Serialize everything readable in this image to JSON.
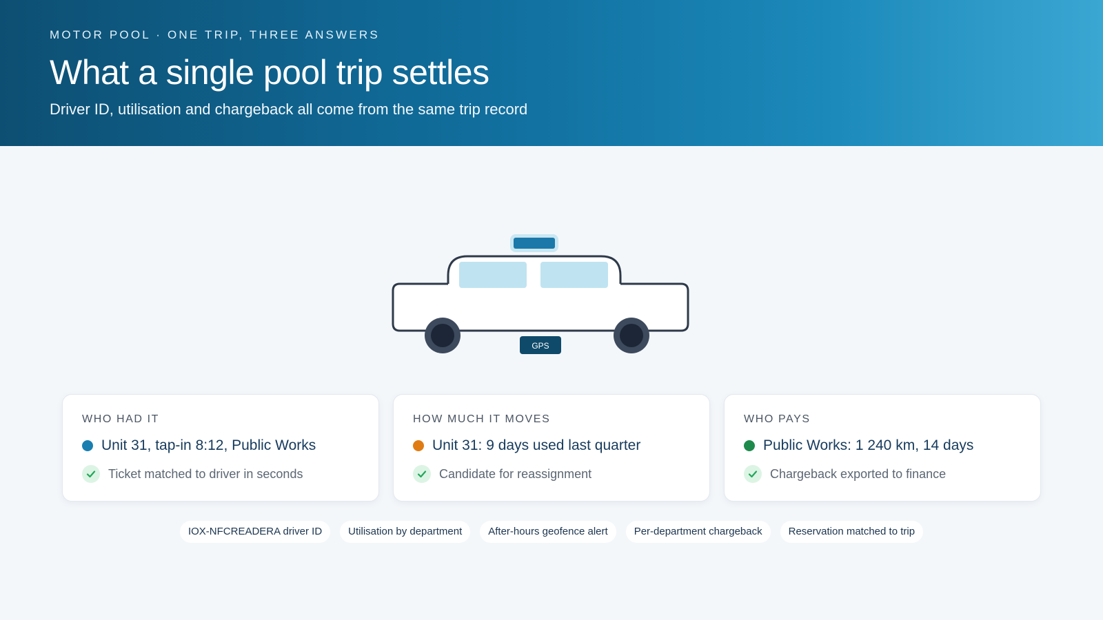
{
  "header": {
    "eyebrow": "MOTOR POOL · ONE TRIP, THREE ANSWERS",
    "title": "What a single pool trip settles",
    "subtitle": "Driver ID, utilisation and chargeback all come from the same trip record"
  },
  "vehicle": {
    "badge_label": "GPS",
    "icon": "pool-car-illustration"
  },
  "cards": [
    {
      "label": "WHO HAD IT",
      "value": "Unit 31, tap-in 8:12, Public Works",
      "note": "Ticket matched to driver in seconds",
      "dot_color": "#1a7fb0"
    },
    {
      "label": "HOW MUCH IT MOVES",
      "value": "Unit 31: 9 days used last quarter",
      "note": "Candidate for reassignment",
      "dot_color": "#e07b14"
    },
    {
      "label": "WHO PAYS",
      "value": "Public Works: 1 240 km, 14 days",
      "note": "Chargeback exported to finance",
      "dot_color": "#1e8a4c"
    }
  ],
  "chips": [
    "IOX-NFCREADERA driver ID",
    "Utilisation by department",
    "After-hours geofence alert",
    "Per-department chargeback",
    "Reservation matched to trip"
  ],
  "colors": {
    "header_start": "#0d4f73",
    "header_end": "#3aa6d2",
    "check_green": "#22a65a",
    "check_bg": "#dcf4e4"
  }
}
